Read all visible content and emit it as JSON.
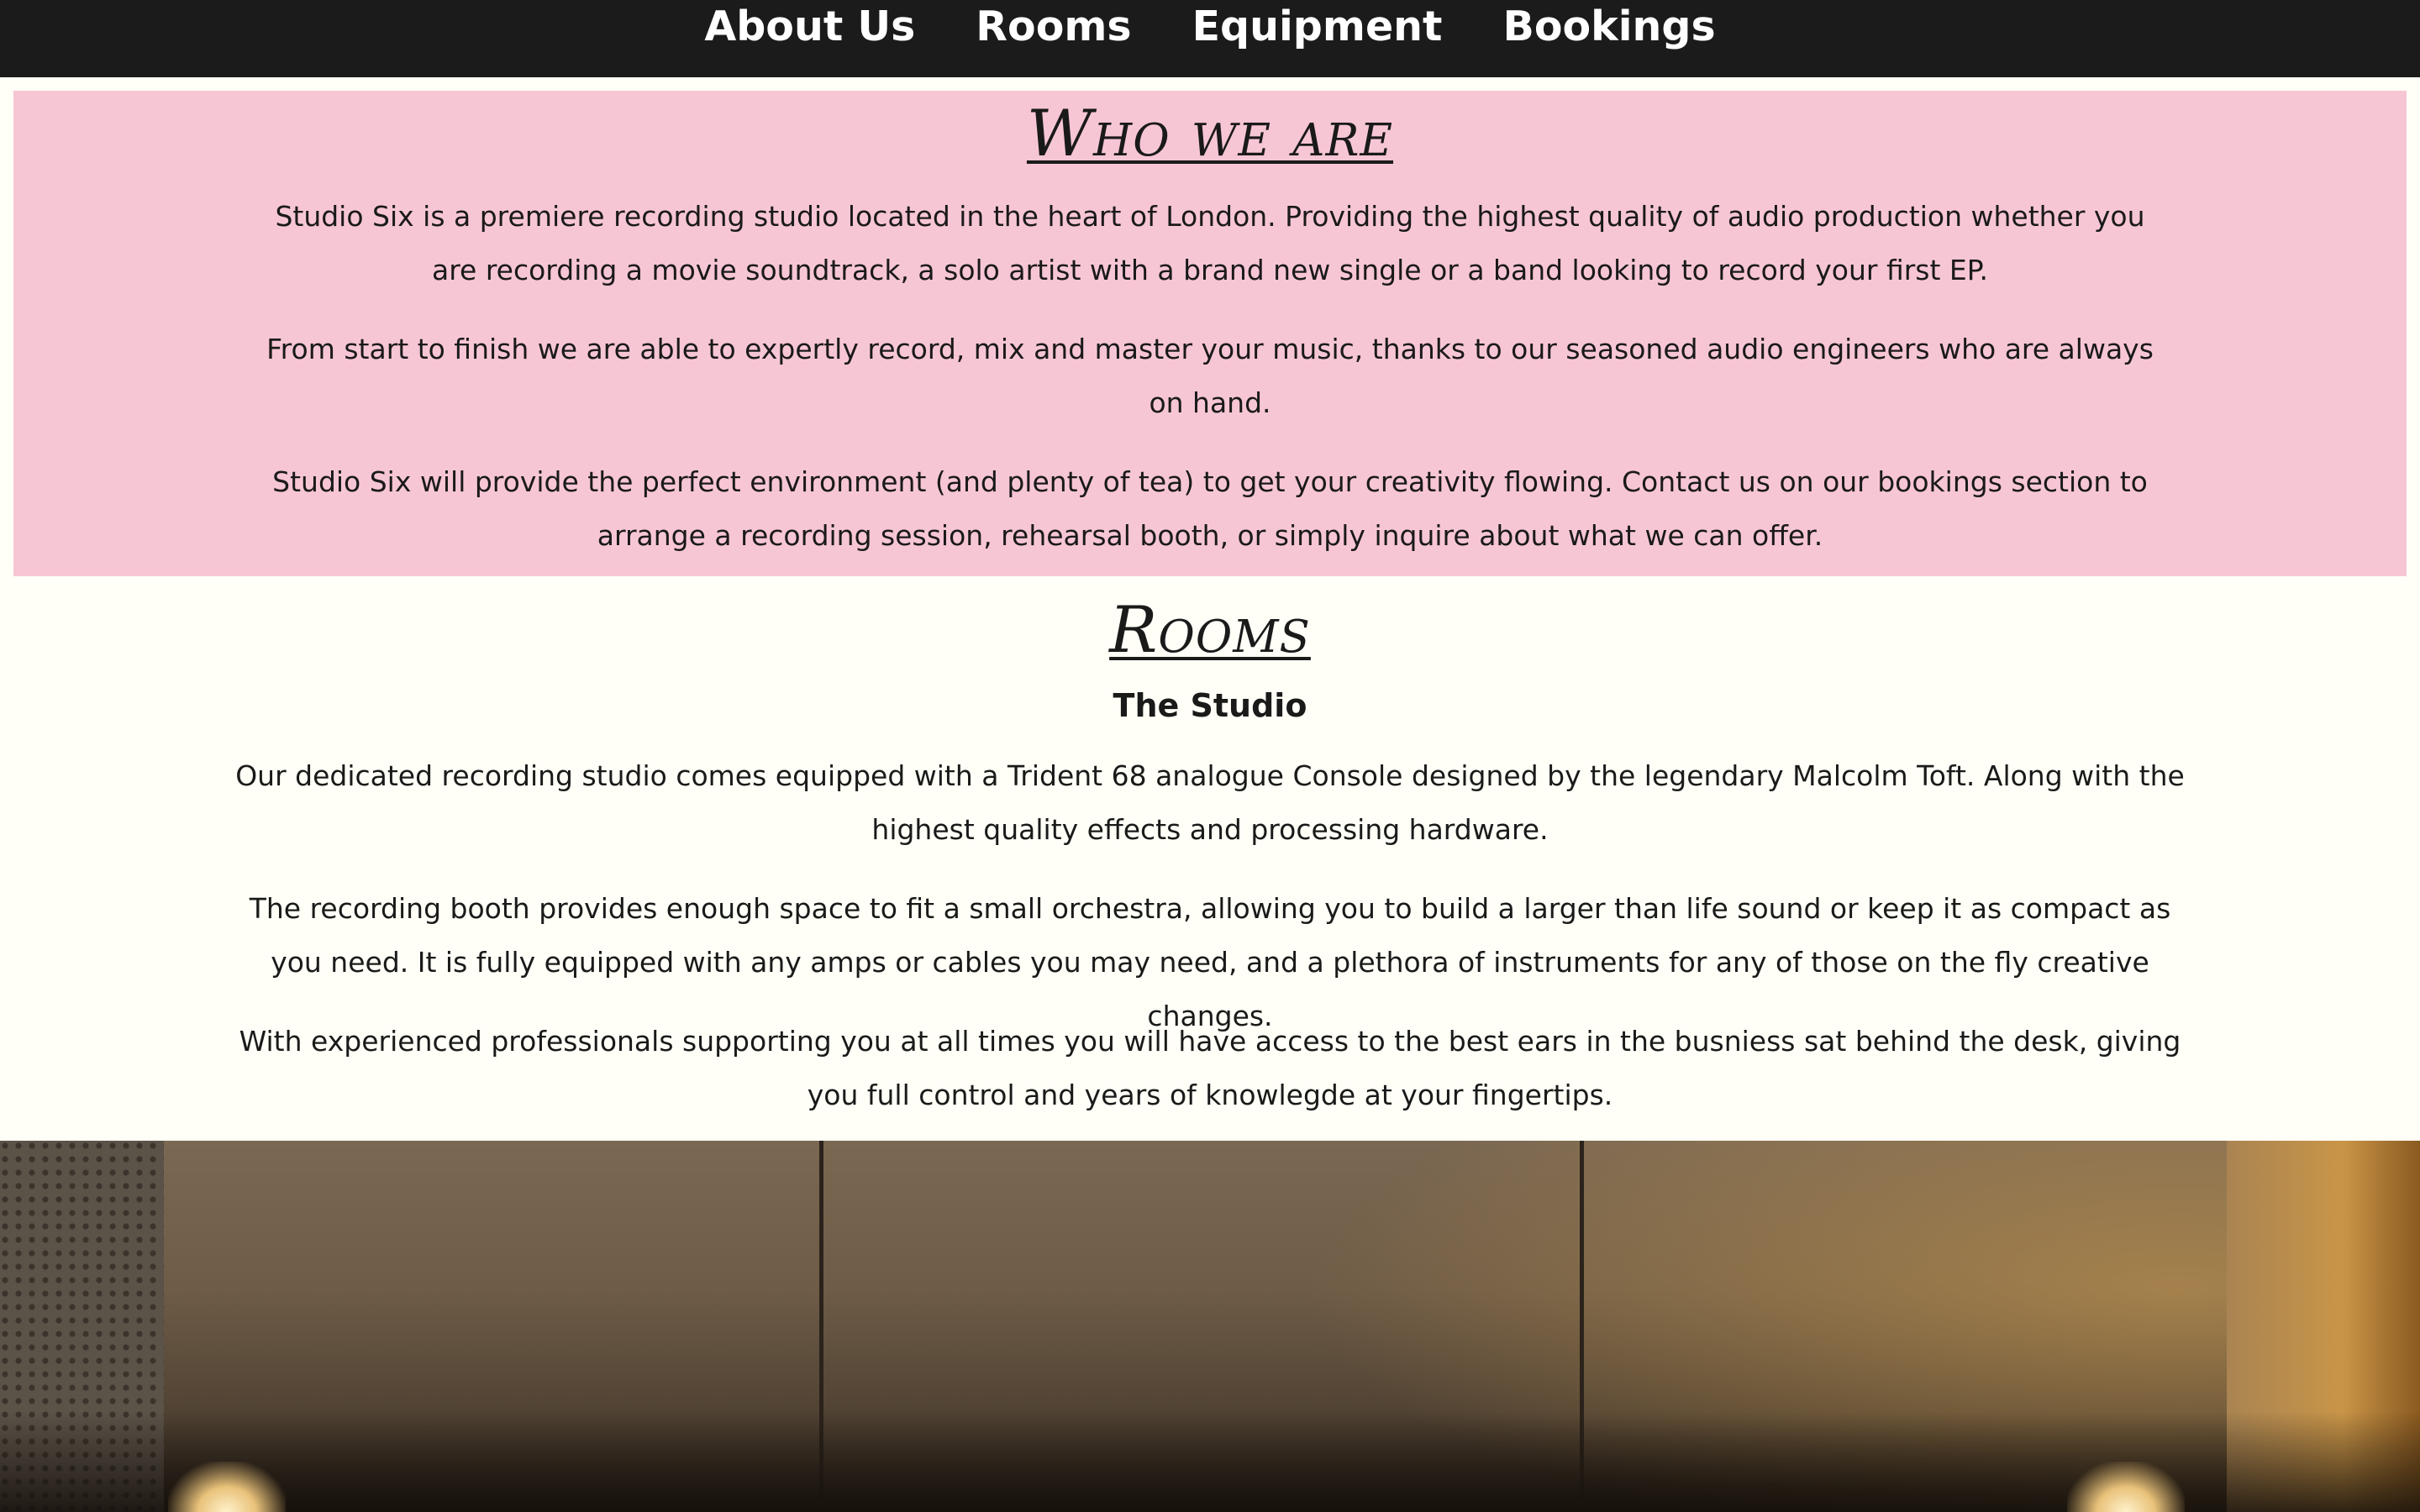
{
  "nav": {
    "items": [
      {
        "label": "About Us"
      },
      {
        "label": "Rooms"
      },
      {
        "label": "Equipment"
      },
      {
        "label": "Bookings"
      }
    ]
  },
  "about": {
    "title": "Who we are",
    "paragraphs": [
      "Studio Six is a premiere recording studio located in the heart of London. Providing the highest quality of audio production whether you are recording a movie soundtrack, a solo artist with a brand new single or a band looking to record your first EP.",
      "From start to finish we are able to expertly record, mix and master your music, thanks to our seasoned audio engineers who are always on hand.",
      "Studio Six will provide the perfect environment (and plenty of tea) to get your creativity flowing. Contact us on our bookings section to arrange a recording session, rehearsal booth, or simply inquire about what we can offer."
    ],
    "background_color": "#f7c6d5"
  },
  "rooms": {
    "title": "Rooms",
    "subtitle": "The Studio",
    "paragraphs": [
      "Our dedicated recording studio comes equipped with a Trident 68 analogue Console designed by the legendary Malcolm Toft. Along with the highest quality effects and processing hardware.",
      "The recording booth provides enough space to fit a small orchestra, allowing you to build a larger than life sound or keep it as compact as you need. It is fully equipped with any amps or cables you may need, and a plethora of instruments for any of those on the fly creative changes.",
      "With experienced professionals supporting you at all times you will have access to the best ears in the busniess sat behind the desk, giving you full control and years of knowlegde at your fingertips."
    ]
  },
  "colors": {
    "nav_background": "#1b1b1b",
    "page_background": "#fffff7",
    "text": "#1a1a1a"
  }
}
